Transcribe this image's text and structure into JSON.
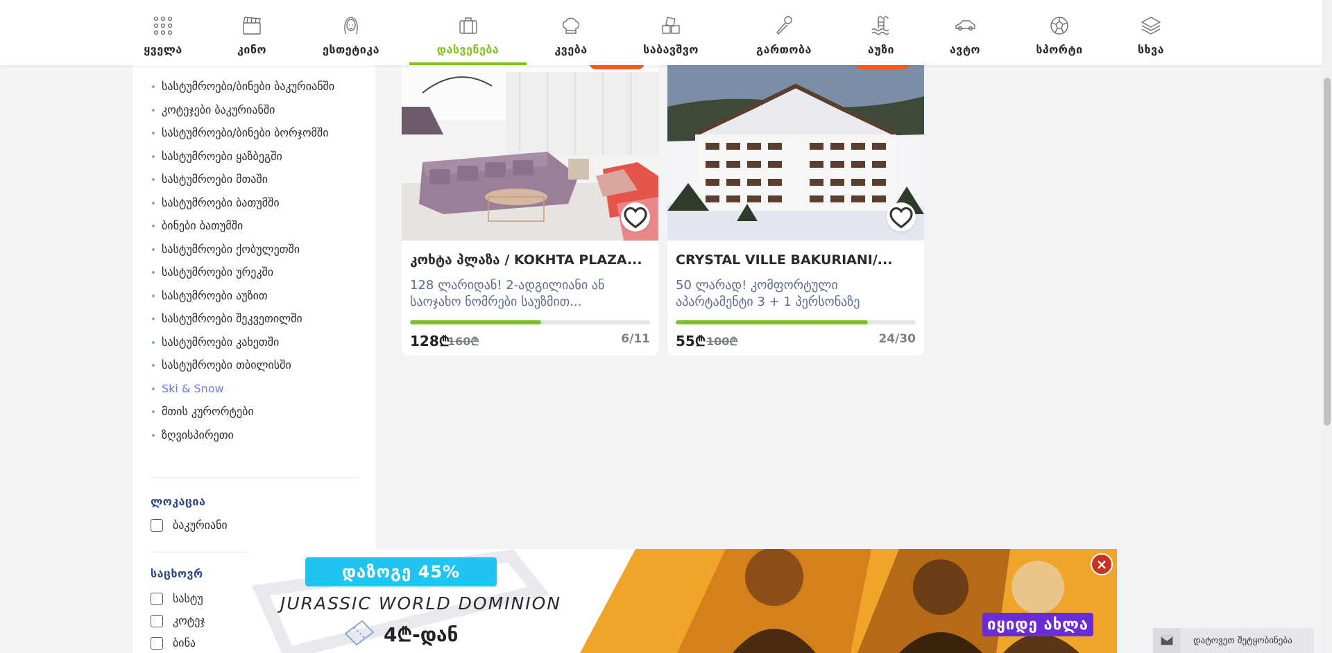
{
  "nav": {
    "items": [
      {
        "label": "ყველა",
        "icon": "grid-icon"
      },
      {
        "label": "კინო",
        "icon": "clapperboard-icon"
      },
      {
        "label": "ესთეტიკა",
        "icon": "woman-face-icon"
      },
      {
        "label": "დასვენება",
        "icon": "suitcase-icon",
        "active": true
      },
      {
        "label": "კვება",
        "icon": "chef-hat-icon"
      },
      {
        "label": "საბავშვო",
        "icon": "toy-blocks-icon"
      },
      {
        "label": "გართობა",
        "icon": "microphone-icon"
      },
      {
        "label": "აუზი",
        "icon": "pool-icon"
      },
      {
        "label": "ავტო",
        "icon": "car-icon"
      },
      {
        "label": "სპორტი",
        "icon": "ball-icon"
      },
      {
        "label": "სხვა",
        "icon": "layers-icon"
      }
    ],
    "accent": "#7ec31f"
  },
  "sidebar": {
    "categories": [
      "სასტუმროები/ბინები ბაკურიანში",
      "კოტეჯები ბაკურიანში",
      "სასტუმროები/ბინები ბორჯომში",
      "სასტუმროები ყაზბეგში",
      "სასტუმროები მთაში",
      "სასტუმროები ბათუმში",
      "ბინები ბათუმში",
      "სასტუმროები ქობულეთში",
      "სასტუმროები ურეკში",
      "სასტუმროები აუზით",
      "სასტუმროები შეკვეთილში",
      "სასტუმროები კახეთში",
      "სასტუმროები თბილისში",
      "Ski & Snow",
      "მთის კურორტები",
      "ზღვისპირეთი"
    ],
    "active_category": "Ski & Snow",
    "location": {
      "title": "ლოკაცია",
      "options": [
        "ბაკურიანი"
      ]
    },
    "accommodation": {
      "title": "საცხოვრ",
      "options": [
        "სასტუ",
        "კოტეჯ",
        "ბინა"
      ]
    }
  },
  "cards": [
    {
      "title": "კოხტა პლაზა / KOKHTA PLAZA...",
      "description": "128 ლარიდან! 2-ადგილიანი ან საოჯახო ნომრები საუზმით...",
      "price": "128₾",
      "old_price": "160₾",
      "sold": "6/11",
      "progress": 0.545
    },
    {
      "title": "CRYSTAL VILLE BAKURIANI/...",
      "description": "50 ლარად! კომფორტული აპარტამენტი 3 + 1 პერსონაზე",
      "price": "55₾",
      "old_price": "100₾",
      "sold": "24/30",
      "progress": 0.8
    }
  ],
  "banner": {
    "discount": "დაზოგე 45%",
    "movie": "JURASSIC WORLD DOMINION",
    "price": "4₾-დან",
    "cta": "იყიდე ახლა",
    "close": "×"
  },
  "messages": {
    "label": "დატოვეთ შეტყობინება"
  }
}
